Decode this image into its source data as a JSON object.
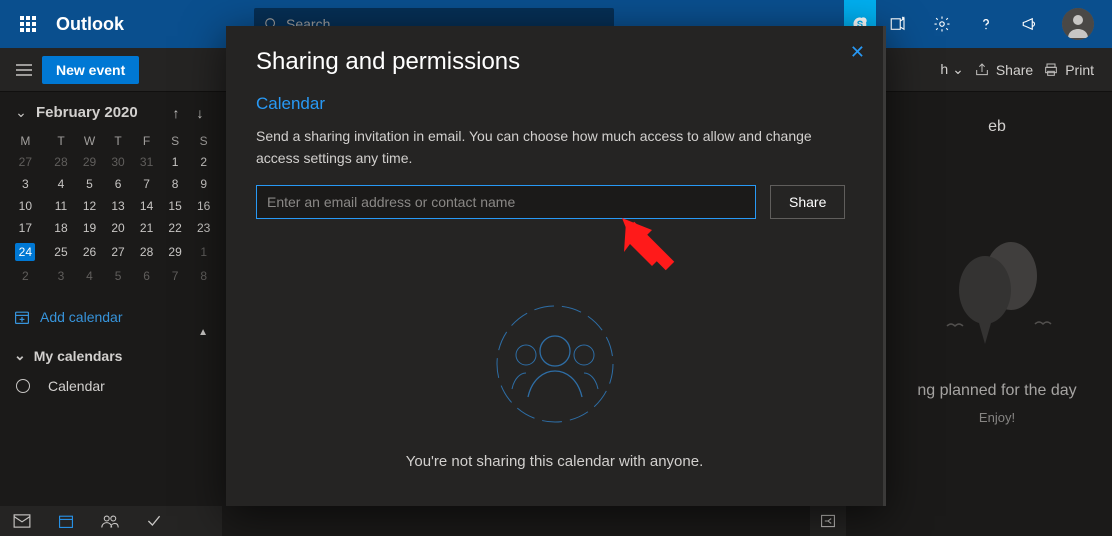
{
  "header": {
    "brand": "Outlook",
    "search_placeholder": "Search"
  },
  "toolbar": {
    "new_event_label": "New event",
    "view_fragment_right": "h",
    "share_label": "Share",
    "print_label": "Print"
  },
  "sidebar": {
    "month_title": "February 2020",
    "dow_labels": [
      "M",
      "T",
      "W",
      "T",
      "F",
      "S",
      "S"
    ],
    "weeks": [
      {
        "cells": [
          {
            "n": "27",
            "other": true
          },
          {
            "n": "28",
            "other": true
          },
          {
            "n": "29",
            "other": true
          },
          {
            "n": "30",
            "other": true
          },
          {
            "n": "31",
            "other": true
          },
          {
            "n": "1"
          },
          {
            "n": "2"
          }
        ]
      },
      {
        "cells": [
          {
            "n": "3"
          },
          {
            "n": "4"
          },
          {
            "n": "5"
          },
          {
            "n": "6"
          },
          {
            "n": "7"
          },
          {
            "n": "8"
          },
          {
            "n": "9"
          }
        ]
      },
      {
        "cells": [
          {
            "n": "10"
          },
          {
            "n": "11"
          },
          {
            "n": "12"
          },
          {
            "n": "13"
          },
          {
            "n": "14"
          },
          {
            "n": "15"
          },
          {
            "n": "16"
          }
        ]
      },
      {
        "cells": [
          {
            "n": "17"
          },
          {
            "n": "18"
          },
          {
            "n": "19"
          },
          {
            "n": "20"
          },
          {
            "n": "21"
          },
          {
            "n": "22"
          },
          {
            "n": "23"
          }
        ]
      },
      {
        "cells": [
          {
            "n": "24",
            "today": true
          },
          {
            "n": "25"
          },
          {
            "n": "26"
          },
          {
            "n": "27"
          },
          {
            "n": "28"
          },
          {
            "n": "29"
          },
          {
            "n": "1",
            "other": true
          }
        ]
      },
      {
        "cells": [
          {
            "n": "2",
            "other": true
          },
          {
            "n": "3",
            "other": true
          },
          {
            "n": "4",
            "other": true
          },
          {
            "n": "5",
            "other": true
          },
          {
            "n": "6",
            "other": true
          },
          {
            "n": "7",
            "other": true
          },
          {
            "n": "8",
            "other": true
          }
        ]
      }
    ],
    "add_calendar_label": "Add calendar",
    "my_calendars_label": "My calendars",
    "calendar_item_label": "Calendar"
  },
  "daypanel": {
    "day_fragment": "eb",
    "empty_heading": "ng planned for the day",
    "empty_sub": "Enjoy!"
  },
  "modal": {
    "title": "Sharing and permissions",
    "subtitle": "Calendar",
    "desc": "Send a sharing invitation in email. You can choose how much access to allow and change access settings any time.",
    "input_placeholder": "Enter an email address or contact name",
    "share_button_label": "Share",
    "empty_text": "You're not sharing this calendar with anyone."
  }
}
